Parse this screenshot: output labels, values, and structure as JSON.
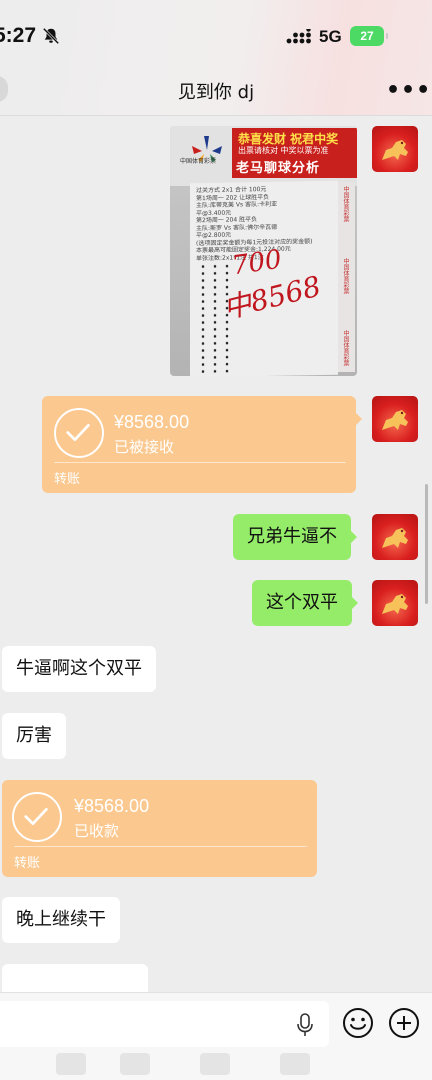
{
  "status_bar": {
    "time": "5:27",
    "network": "5G",
    "battery": "27"
  },
  "nav": {
    "title": "见到你 dj",
    "more": "•••"
  },
  "photo": {
    "banner_line1": "恭喜发财 祝君中奖",
    "banner_line2": "出票请核对 中奖以票为准",
    "banner_line3": "老马聊球分析",
    "logo_text": "中国体育彩票",
    "handwriting_1": "700",
    "handwriting_2": "中8568",
    "ticket_lines": [
      "过关方式 2x1        合计 100元",
      "第1场周一 202 让球胜平负",
      "主队:库蒂克美 Vs 客队:卡利亚",
      "平@3.400元",
      "第2场周一 204 胜平负",
      "主队:斯罗 Vs 客队:佛尔辛瓦德",
      "平@2.800元",
      "(选项固定奖金额为每1元投注对应的奖金额)",
      "本票最高可能固定奖金:1,224.00元",
      "单张注数:2x1*1注 共1注"
    ],
    "side_text": "中国体育彩票"
  },
  "messages": [
    {
      "type": "transfer",
      "side": "right",
      "amount": "¥8568.00",
      "status": "已被接收",
      "label": "转账"
    },
    {
      "type": "text",
      "side": "right",
      "text": "兄弟牛逼不"
    },
    {
      "type": "text",
      "side": "right",
      "text": "这个双平"
    },
    {
      "type": "text",
      "side": "left",
      "text": "牛逼啊这个双平"
    },
    {
      "type": "text",
      "side": "left",
      "text": "厉害"
    },
    {
      "type": "transfer",
      "side": "left",
      "amount": "¥8568.00",
      "status": "已收款",
      "label": "转账"
    },
    {
      "type": "text",
      "side": "left",
      "text": "晚上继续干"
    }
  ],
  "input_bar": {
    "mic_icon": "microphone-icon",
    "emoji_icon": "emoji-icon",
    "plus_icon": "plus-icon"
  },
  "colors": {
    "self_bubble": "#95ec69",
    "transfer": "#fbc88f",
    "background": "#ededed"
  }
}
